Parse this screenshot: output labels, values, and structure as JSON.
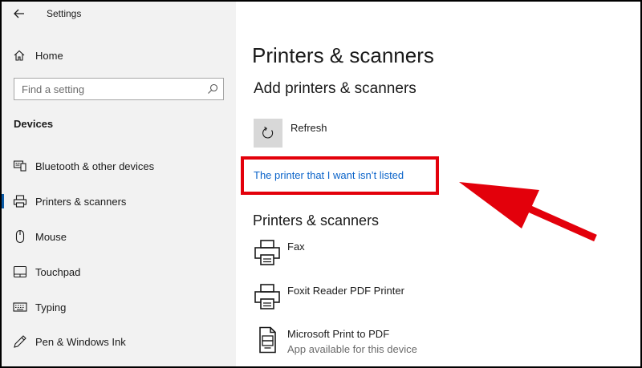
{
  "window": {
    "title": "Settings"
  },
  "sidebar": {
    "home_label": "Home",
    "search_placeholder": "Find a setting",
    "section_label": "Devices",
    "items": [
      {
        "label": "Bluetooth & other devices",
        "icon": "bluetooth-devices-icon",
        "active": false
      },
      {
        "label": "Printers & scanners",
        "icon": "printer-icon",
        "active": true
      },
      {
        "label": "Mouse",
        "icon": "mouse-icon",
        "active": false
      },
      {
        "label": "Touchpad",
        "icon": "touchpad-icon",
        "active": false
      },
      {
        "label": "Typing",
        "icon": "keyboard-icon",
        "active": false
      },
      {
        "label": "Pen & Windows Ink",
        "icon": "pen-icon",
        "active": false
      }
    ]
  },
  "main": {
    "title": "Printers & scanners",
    "add_section_title": "Add printers & scanners",
    "refresh_label": "Refresh",
    "not_listed_link": "The printer that I want isn’t listed",
    "list_section_title": "Printers & scanners",
    "printers": [
      {
        "name": "Fax",
        "status": "",
        "icon": "printer-icon"
      },
      {
        "name": "Foxit Reader PDF Printer",
        "status": "",
        "icon": "printer-icon"
      },
      {
        "name": "Microsoft Print to PDF",
        "status": "App available for this device",
        "icon": "print-to-pdf-icon"
      }
    ]
  },
  "colors": {
    "accent": "#0a63c9",
    "annotation_red": "#e3000b",
    "sidebar_bg": "#f2f2f2",
    "tile_bg": "#d8d8d8"
  }
}
